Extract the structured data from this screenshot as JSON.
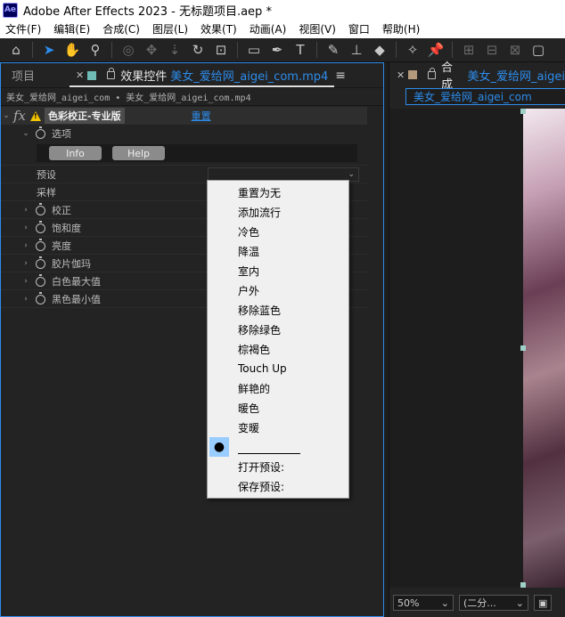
{
  "app": {
    "logo": "Ae",
    "title": "Adobe After Effects 2023 - 无标题项目.aep *"
  },
  "menu": [
    "文件(F)",
    "编辑(E)",
    "合成(C)",
    "图层(L)",
    "效果(T)",
    "动画(A)",
    "视图(V)",
    "窗口",
    "帮助(H)"
  ],
  "toolbar": {
    "icons": [
      "home-icon",
      "selection-tool-icon",
      "hand-tool-icon",
      "zoom-tool-icon",
      "rotate-tool-icon",
      "camera-orbit-icon",
      "pan-behind-icon",
      "track-z-icon",
      "rectangle-tool-icon",
      "pen-tool-icon",
      "type-tool-icon",
      "brush-tool-icon",
      "clone-stamp-icon",
      "eraser-icon",
      "roto-brush-icon",
      "puppet-pin-icon"
    ]
  },
  "left_panel": {
    "tab_project": "项目",
    "tab_effects_prefix": "效果控件",
    "tab_effects_file": "美女_爱给网_aigei_com.mp4",
    "breadcrumb": "美女_爱给网_aigei_com • 美女_爱给网_aigei_com.mp4",
    "effect": {
      "fx": "fx",
      "name": "色彩校正-专业版",
      "reset": "重置"
    },
    "options_label": "选项",
    "info_button": "Info",
    "help_button": "Help",
    "preset_label": "预设",
    "sampling_label": "采样",
    "properties": [
      "校正",
      "饱和度",
      "亮度",
      "胶片伽玛",
      "白色最大值",
      "黑色最小值"
    ]
  },
  "dropdown": {
    "items": [
      "重置为无",
      "添加流行",
      "冷色",
      "降温",
      "室内",
      "户外",
      "移除蓝色",
      "移除绿色",
      "棕褐色",
      "Touch Up",
      "鲜艳的",
      "暖色",
      "变暖"
    ],
    "selected_marker": "●",
    "open_preset": "打开预设:",
    "save_preset": "保存预设:"
  },
  "right_panel": {
    "tab_prefix": "合成",
    "tab_comp": "美女_爱给网_aigei",
    "comp_name": "美女_爱给网_aigei_com",
    "zoom": "50%",
    "resolution": "(二分..."
  }
}
